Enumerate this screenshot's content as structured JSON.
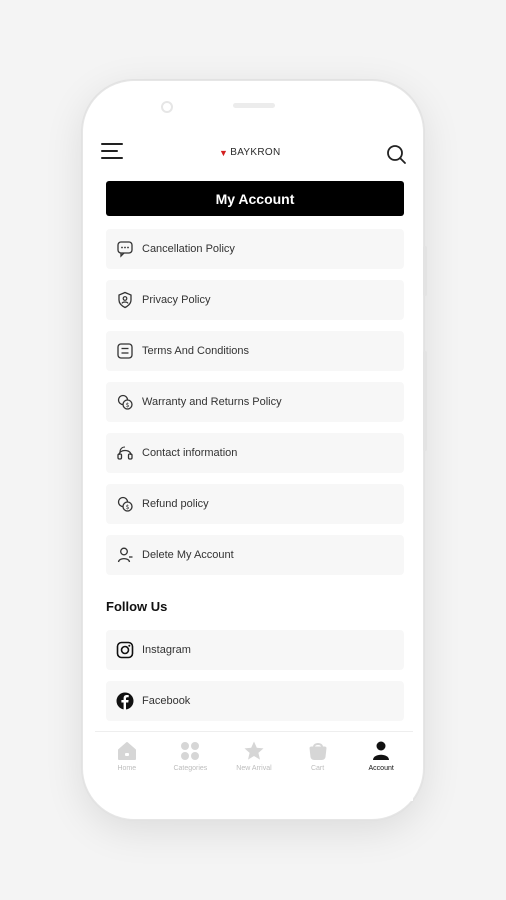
{
  "header": {
    "brand": "BAYKRON",
    "title": "My Account"
  },
  "menu": [
    {
      "label": "Cancellation Policy",
      "icon": "chat-bubble-icon"
    },
    {
      "label": "Privacy Policy",
      "icon": "shield-user-icon"
    },
    {
      "label": "Terms And Conditions",
      "icon": "document-list-icon"
    },
    {
      "label": "Warranty and Returns Policy",
      "icon": "coins-icon"
    },
    {
      "label": "Contact information",
      "icon": "headset-icon"
    },
    {
      "label": "Refund policy",
      "icon": "coins-icon"
    },
    {
      "label": "Delete My Account",
      "icon": "user-remove-icon"
    }
  ],
  "follow": {
    "heading": "Follow Us",
    "items": [
      {
        "label": "Instagram",
        "icon": "instagram-icon"
      },
      {
        "label": "Facebook",
        "icon": "facebook-icon"
      }
    ]
  },
  "nav": [
    {
      "label": "Home",
      "icon": "home-icon",
      "active": false
    },
    {
      "label": "Categories",
      "icon": "grid-icon",
      "active": false
    },
    {
      "label": "New Arrival",
      "icon": "star-icon",
      "active": false
    },
    {
      "label": "Cart",
      "icon": "bag-icon",
      "active": false
    },
    {
      "label": "Account",
      "icon": "user-icon",
      "active": true
    }
  ],
  "colors": {
    "accent": "#000000",
    "brand_mark": "#d32020",
    "item_bg": "#f7f7f7"
  }
}
